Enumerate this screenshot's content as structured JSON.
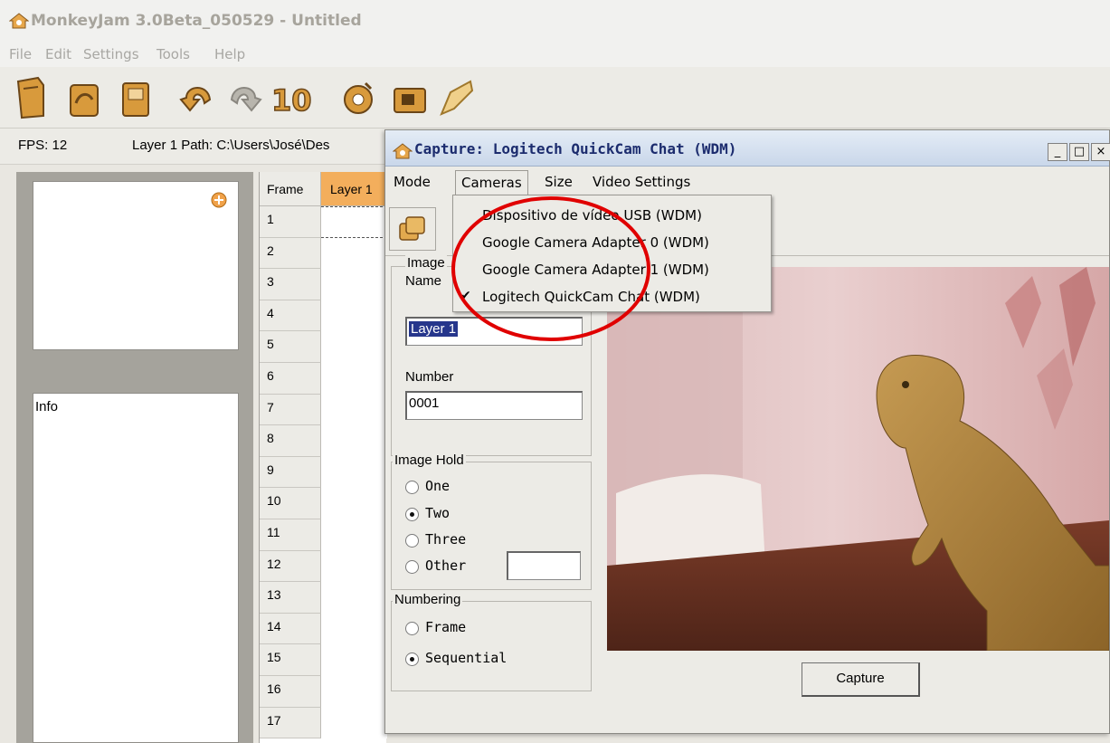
{
  "main": {
    "title": "MonkeyJam 3.0Beta_050529 - Untitled",
    "menu": [
      "File",
      "Edit",
      "Settings",
      "Tools",
      "Help"
    ],
    "fps": "FPS: 12",
    "layer_path": "Layer 1 Path: C:\\Users\\José\\Des",
    "toolbar_count_label": "10"
  },
  "info_panel": {
    "label": "Info"
  },
  "grid": {
    "frame_header": "Frame",
    "layer_header": "Layer 1",
    "rows": [
      "1",
      "2",
      "3",
      "4",
      "5",
      "6",
      "7",
      "8",
      "9",
      "10",
      "11",
      "12",
      "13",
      "14",
      "15",
      "16",
      "17"
    ]
  },
  "capture": {
    "title": "Capture: Logitech QuickCam Chat (WDM)",
    "window_buttons": [
      "_",
      "□",
      "×"
    ],
    "menu": [
      "Mode",
      "Cameras",
      "Size",
      "Video Settings"
    ],
    "image_group": "Image",
    "name_label": "Name",
    "name_value": "Layer 1",
    "number_label": "Number",
    "number_value": "0001",
    "image_hold": {
      "title": "Image Hold",
      "options": [
        "One",
        "Two",
        "Three",
        "Other"
      ],
      "selected": "Two"
    },
    "numbering": {
      "title": "Numbering",
      "options": [
        "Frame",
        "Sequential"
      ],
      "selected": "Sequential"
    },
    "capture_button": "Capture"
  },
  "cameras_menu": {
    "items": [
      {
        "label": "Dispositivo de vídeo USB (WDM)",
        "checked": false
      },
      {
        "label": "Google Camera Adapter 0 (WDM)",
        "checked": false
      },
      {
        "label": "Google Camera Adapter 1 (WDM)",
        "checked": false
      },
      {
        "label": "Logitech QuickCam Chat  (WDM)",
        "checked": true
      }
    ],
    "check_mark": "✔"
  },
  "colors": {
    "layer_header_bg": "#f3ae5c",
    "selection_bg": "#26368c",
    "annotation": "#e00000",
    "title_text": "#1c2c6e"
  },
  "icons": [
    "app-icon",
    "open-icon",
    "save-icon",
    "undo-icon",
    "redo-icon",
    "capture-icon",
    "add-icon",
    "check-icon"
  ]
}
